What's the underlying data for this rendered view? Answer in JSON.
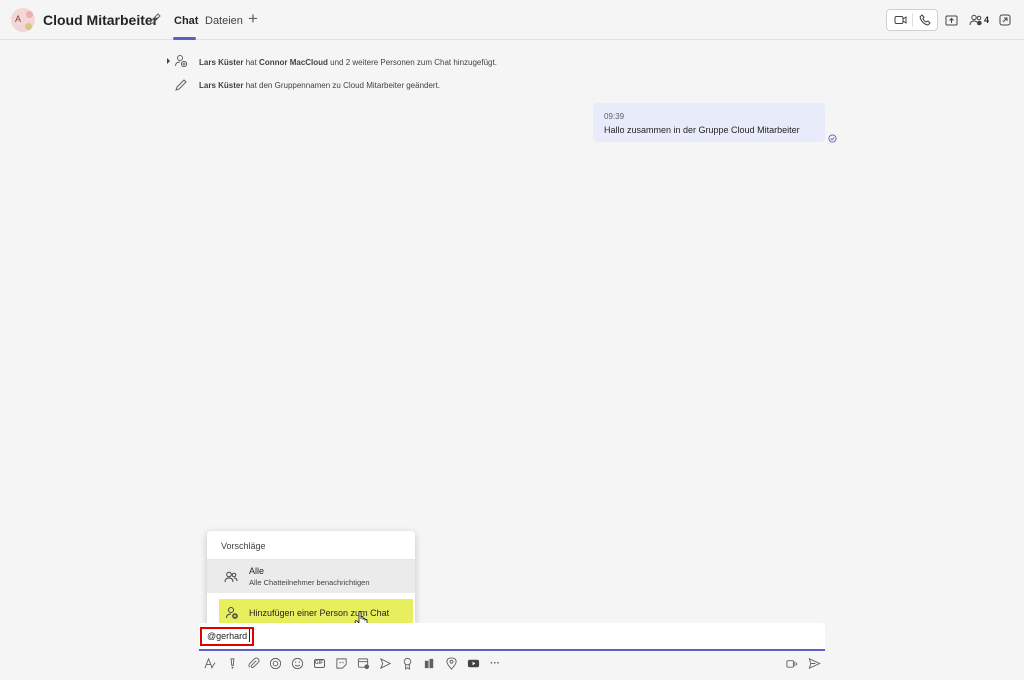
{
  "header": {
    "avatar_letter": "A",
    "title": "Cloud Mitarbeiter",
    "tabs": [
      {
        "label": "Chat",
        "active": true
      },
      {
        "label": "Dateien",
        "active": false
      }
    ],
    "add_tab_symbol": "+",
    "participants_count": "4",
    "icons": [
      "video-call-icon",
      "audio-call-icon",
      "share-screen-icon",
      "participants-icon",
      "popout-icon"
    ]
  },
  "system_messages": [
    {
      "actor": "Lars Küster",
      "text1": " hat ",
      "subject": "Connor MacCloud",
      "text2": " und 2 weitere Personen zum Chat hinzugefügt."
    },
    {
      "actor": "Lars Küster",
      "text1": " hat den Gruppennamen zu Cloud Mitarbeiter geändert."
    }
  ],
  "message": {
    "time": "09:39",
    "text": "Hallo zusammen in der Gruppe Cloud Mitarbeiter"
  },
  "suggestions": {
    "header": "Vorschläge",
    "all_title": "Alle",
    "all_subtitle": "Alle Chatteilnehmer benachrichtigen",
    "add_person": "Hinzufügen einer Person zum Chat"
  },
  "compose": {
    "value": "@gerhard"
  },
  "toolbar": {
    "gif_label": "GIF",
    "more_label": "···",
    "icons": [
      "format-icon",
      "important-icon",
      "attach-icon",
      "loop-icon",
      "emoji-icon",
      "gif-icon",
      "sticker-icon",
      "schedule-meeting-icon",
      "stream-icon",
      "praise-icon",
      "approvals-icon",
      "location-icon",
      "youtube-icon",
      "more-icon",
      "dictate-icon",
      "send-icon"
    ]
  },
  "colors": {
    "accent": "#5b5fc7",
    "bubble": "#e8ebfa",
    "highlight": "#e8ef5e",
    "annotation": "#e00000"
  }
}
